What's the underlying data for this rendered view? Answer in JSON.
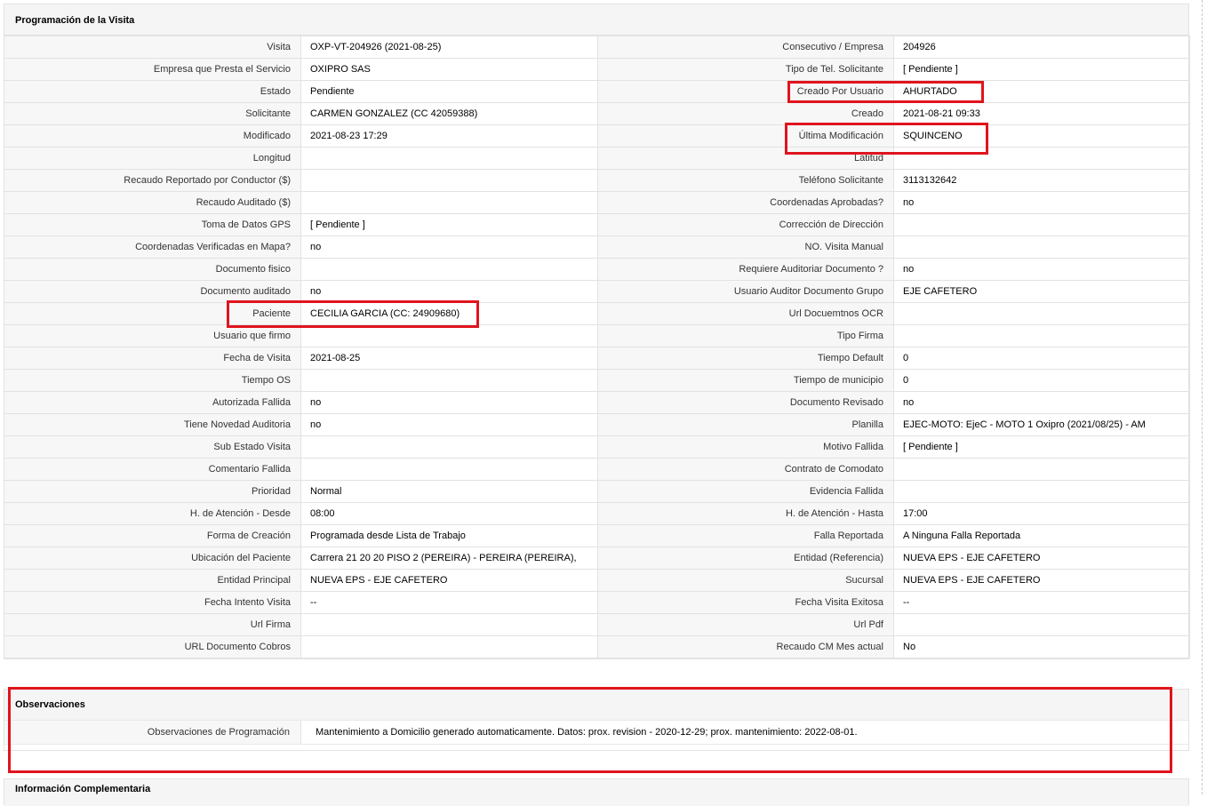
{
  "colors": {
    "highlight": "#e0141e",
    "header_bg": "#f5f5f5",
    "border": "#e2e2e2"
  },
  "programacion": {
    "title": "Programación de la Visita",
    "rows": [
      {
        "l1": "Visita",
        "v1": "OXP-VT-204926 (2021-08-25)",
        "l2": "Consecutivo / Empresa",
        "v2": "204926"
      },
      {
        "l1": "Empresa que Presta el Servicio",
        "v1": "OXIPRO SAS",
        "l2": "Tipo de Tel. Solicitante",
        "v2": "[ Pendiente ]"
      },
      {
        "l1": "Estado",
        "v1": "Pendiente",
        "l2": "Creado Por Usuario",
        "v2": "AHURTADO"
      },
      {
        "l1": "Solicitante",
        "v1": "CARMEN GONZALEZ (CC 42059388)",
        "l2": "Creado",
        "v2": "2021-08-21 09:33"
      },
      {
        "l1": "Modificado",
        "v1": "2021-08-23 17:29",
        "l2": "Última Modificación",
        "v2": "SQUINCENO"
      },
      {
        "l1": "Longitud",
        "v1": "",
        "l2": "Latitud",
        "v2": ""
      },
      {
        "l1": "Recaudo Reportado por Conductor ($)",
        "v1": "",
        "l2": "Teléfono Solicitante",
        "v2": "3113132642"
      },
      {
        "l1": "Recaudo Auditado ($)",
        "v1": "",
        "l2": "Coordenadas Aprobadas?",
        "v2": "no"
      },
      {
        "l1": "Toma de Datos GPS",
        "v1": "[ Pendiente ]",
        "l2": "Corrección de Dirección",
        "v2": ""
      },
      {
        "l1": "Coordenadas Verificadas en Mapa?",
        "v1": "no",
        "l2": "NO. Visita Manual",
        "v2": ""
      },
      {
        "l1": "Documento fisico",
        "v1": "",
        "l2": "Requiere Auditoriar Documento ?",
        "v2": "no"
      },
      {
        "l1": "Documento auditado",
        "v1": "no",
        "l2": "Usuario Auditor Documento Grupo",
        "v2": "EJE CAFETERO"
      },
      {
        "l1": "Paciente",
        "v1": "CECILIA GARCIA (CC: 24909680)",
        "l2": "Url Docuemtnos OCR",
        "v2": ""
      },
      {
        "l1": "Usuario que firmo",
        "v1": "",
        "l2": "Tipo Firma",
        "v2": ""
      },
      {
        "l1": "Fecha de Visita",
        "v1": "2021-08-25",
        "l2": "Tiempo Default",
        "v2": "0"
      },
      {
        "l1": "Tiempo OS",
        "v1": "",
        "l2": "Tiempo de municipio",
        "v2": "0"
      },
      {
        "l1": "Autorizada Fallida",
        "v1": "no",
        "l2": "Documento Revisado",
        "v2": "no"
      },
      {
        "l1": "Tiene Novedad Auditoria",
        "v1": "no",
        "l2": "Planilla",
        "v2": "EJEC-MOTO: EjeC - MOTO 1 Oxipro (2021/08/25) - AM"
      },
      {
        "l1": "Sub Estado Visita",
        "v1": "",
        "l2": "Motivo Fallida",
        "v2": "[ Pendiente ]"
      },
      {
        "l1": "Comentario Fallida",
        "v1": "",
        "l2": "Contrato de Comodato",
        "v2": ""
      },
      {
        "l1": "Prioridad",
        "v1": "Normal",
        "l2": "Evidencia Fallida",
        "v2": ""
      },
      {
        "l1": "H. de Atención - Desde",
        "v1": "08:00",
        "l2": "H. de Atención - Hasta",
        "v2": "17:00"
      },
      {
        "l1": "Forma de Creación",
        "v1": "Programada desde Lista de Trabajo",
        "l2": "Falla Reportada",
        "v2": "A Ninguna Falla Reportada"
      },
      {
        "l1": "Ubicación del Paciente",
        "v1": "Carrera 21 20 20 PISO 2 (PEREIRA) - PEREIRA (PEREIRA),",
        "l2": "Entidad (Referencia)",
        "v2": "NUEVA EPS - EJE CAFETERO"
      },
      {
        "l1": "Entidad Principal",
        "v1": "NUEVA EPS - EJE CAFETERO",
        "l2": "Sucursal",
        "v2": "NUEVA EPS - EJE CAFETERO"
      },
      {
        "l1": "Fecha Intento Visita",
        "v1": "--",
        "l2": "Fecha Visita Exitosa",
        "v2": "--"
      },
      {
        "l1": "Url Firma",
        "v1": "",
        "l2": "Url Pdf",
        "v2": ""
      },
      {
        "l1": "URL Documento Cobros",
        "v1": "",
        "l2": "Recaudo CM Mes actual",
        "v2": "No"
      }
    ]
  },
  "observaciones": {
    "title": "Observaciones",
    "label": "Observaciones de Programación",
    "value": "Mantenimiento a Domicilio generado automaticamente. Datos: prox. revision - 2020-12-29; prox. mantenimiento: 2022-08-01."
  },
  "complementaria": {
    "title": "Información Complementaria"
  }
}
